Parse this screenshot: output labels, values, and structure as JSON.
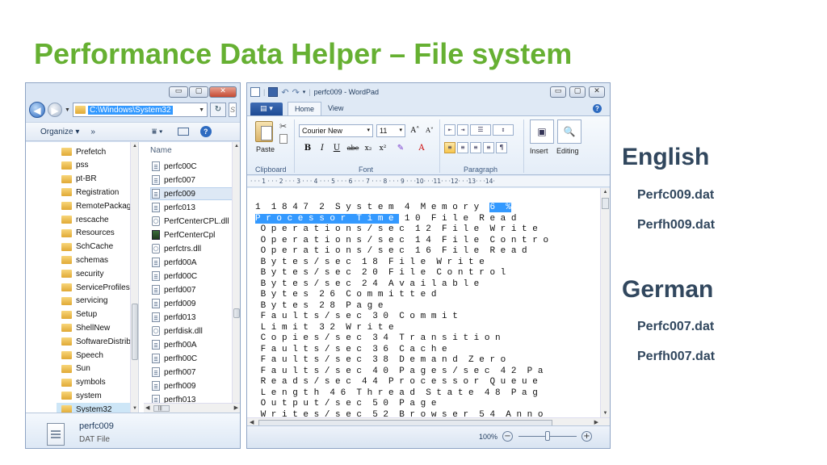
{
  "slide": {
    "title": "Performance Data Helper – File system"
  },
  "explorer": {
    "window_buttons": [
      "▭",
      "▢",
      "✕"
    ],
    "address": "C:\\Windows\\System32",
    "refresh": "↻",
    "search_stub": "S",
    "toolbar": {
      "organize": "Organize ▾",
      "more": "»",
      "views": "⩸ ▾",
      "help": "?"
    },
    "nav_items": [
      {
        "label": "Prefetch"
      },
      {
        "label": "pss"
      },
      {
        "label": "pt-BR"
      },
      {
        "label": "Registration"
      },
      {
        "label": "RemotePackage"
      },
      {
        "label": "rescache"
      },
      {
        "label": "Resources"
      },
      {
        "label": "SchCache"
      },
      {
        "label": "schemas"
      },
      {
        "label": "security"
      },
      {
        "label": "ServiceProfiles"
      },
      {
        "label": "servicing"
      },
      {
        "label": "Setup"
      },
      {
        "label": "ShellNew"
      },
      {
        "label": "SoftwareDistrib"
      },
      {
        "label": "Speech"
      },
      {
        "label": "Sun"
      },
      {
        "label": "symbols"
      },
      {
        "label": "system"
      },
      {
        "label": "System32"
      }
    ],
    "selected_nav": "System32",
    "column_header": "Name",
    "files": [
      {
        "label": "perfc00C",
        "icon": "doc"
      },
      {
        "label": "perfc007",
        "icon": "doc"
      },
      {
        "label": "perfc009",
        "icon": "doc"
      },
      {
        "label": "perfc013",
        "icon": "doc"
      },
      {
        "label": "PerfCenterCPL.dll",
        "icon": "gear"
      },
      {
        "label": "PerfCenterCpl",
        "icon": "cpl"
      },
      {
        "label": "perfctrs.dll",
        "icon": "gear"
      },
      {
        "label": "perfd00A",
        "icon": "doc"
      },
      {
        "label": "perfd00C",
        "icon": "doc"
      },
      {
        "label": "perfd007",
        "icon": "doc"
      },
      {
        "label": "perfd009",
        "icon": "doc"
      },
      {
        "label": "perfd013",
        "icon": "doc"
      },
      {
        "label": "perfdisk.dll",
        "icon": "gear"
      },
      {
        "label": "perfh00A",
        "icon": "doc"
      },
      {
        "label": "perfh00C",
        "icon": "doc"
      },
      {
        "label": "perfh007",
        "icon": "doc"
      },
      {
        "label": "perfh009",
        "icon": "doc"
      },
      {
        "label": "perfh013",
        "icon": "doc"
      }
    ],
    "selected_file": "perfc009",
    "hscroll_thumb": "|||",
    "details": {
      "name": "perfc009",
      "type": "DAT File"
    }
  },
  "wordpad": {
    "title": "perfc009 - WordPad",
    "window_buttons": [
      "▭",
      "▢",
      "✕"
    ],
    "app_button": "▤ ▾",
    "tabs": [
      "Home",
      "View"
    ],
    "active_tab": "Home",
    "help": "?",
    "ribbon": {
      "paste_label": "Paste",
      "scissors": "✂",
      "font_name": "Courier New",
      "font_size": "11",
      "grow_font": "A˄",
      "shrink_font": "A˅",
      "bold": "B",
      "italic": "I",
      "underline": "U",
      "strike": "abe",
      "subscript": "x₂",
      "superscript": "x²",
      "highlight": "✎",
      "font_color": "A",
      "indent_buttons": [
        "⇤",
        "⇥",
        "☰",
        "↕"
      ],
      "align_buttons": [
        "≡",
        "≡",
        "≡",
        "≡",
        "¶"
      ],
      "insert_label": "Insert",
      "editing_label": "Editing",
      "insert_icon": "▣",
      "editing_icon": "🔍",
      "groups": {
        "clipboard": "Clipboard",
        "font": "Font",
        "paragraph": "Paragraph"
      }
    },
    "ruler": "· · · 1 · · · 2 · · · 3 · · · 4 · · · 5 · · · 6 · · · 7 · · · 8 · · · 9 · · ·10· · ·11· · ·12· · ·13· · ·14·",
    "doc_lines": [
      {
        "pre": "1  1 8 4 7  2  S y s t e m  4  M e m o r y  ",
        "hl": "6  %",
        "post": ""
      },
      {
        "pre": "",
        "hl": "P r o c e s s o r  T i m e ",
        "post": " 1 0  F i l e  R e a d"
      },
      {
        "pre": " O p e r a t i o n s / s e c  1 2  F i l e  W r i t e",
        "hl": "",
        "post": ""
      },
      {
        "pre": " O p e r a t i o n s / s e c  1 4  F i l e  C o n t r o",
        "hl": "",
        "post": ""
      },
      {
        "pre": " O p e r a t i o n s / s e c  1 6  F i l e  R e a d",
        "hl": "",
        "post": ""
      },
      {
        "pre": " B y t e s / s e c  1 8  F i l e  W r i t e",
        "hl": "",
        "post": ""
      },
      {
        "pre": " B y t e s / s e c  2 0  F i l e  C o n t r o l",
        "hl": "",
        "post": ""
      },
      {
        "pre": " B y t e s / s e c  2 4  A v a i l a b l e",
        "hl": "",
        "post": ""
      },
      {
        "pre": " B y t e s  2 6  C o m m i t t e d",
        "hl": "",
        "post": ""
      },
      {
        "pre": " B y t e s  2 8  P a g e",
        "hl": "",
        "post": ""
      },
      {
        "pre": " F a u l t s / s e c  3 0  C o m m i t",
        "hl": "",
        "post": ""
      },
      {
        "pre": " L i m i t  3 2  W r i t e",
        "hl": "",
        "post": ""
      },
      {
        "pre": " C o p i e s / s e c  3 4  T r a n s i t i o n",
        "hl": "",
        "post": ""
      },
      {
        "pre": " F a u l t s / s e c  3 6  C a c h e",
        "hl": "",
        "post": ""
      },
      {
        "pre": " F a u l t s / s e c  3 8  D e m a n d  Z e r o",
        "hl": "",
        "post": ""
      },
      {
        "pre": " F a u l t s / s e c  4 0  P a g e s / s e c  4 2  P a",
        "hl": "",
        "post": ""
      },
      {
        "pre": " R e a d s / s e c  4 4  P r o c e s s o r  Q u e u e",
        "hl": "",
        "post": ""
      },
      {
        "pre": " L e n g t h  4 6  T h r e a d  S t a t e  4 8  P a g",
        "hl": "",
        "post": ""
      },
      {
        "pre": " O u t p u t / s e c  5 0  P a g e",
        "hl": "",
        "post": ""
      },
      {
        "pre": " W r i t e s / s e c  5 2  B r o w s e r  5 4  A n n o",
        "hl": "",
        "post": ""
      }
    ],
    "status": {
      "zoom": "100%",
      "zoom_minus": "−",
      "zoom_plus": "+",
      "zoom_fraction": 0.5
    }
  },
  "languages": [
    {
      "heading": "English",
      "files": [
        "Perfc009.dat",
        "Perfh009.dat"
      ]
    },
    {
      "heading": "German",
      "files": [
        "Perfc007.dat",
        "Perfh007.dat"
      ]
    }
  ]
}
